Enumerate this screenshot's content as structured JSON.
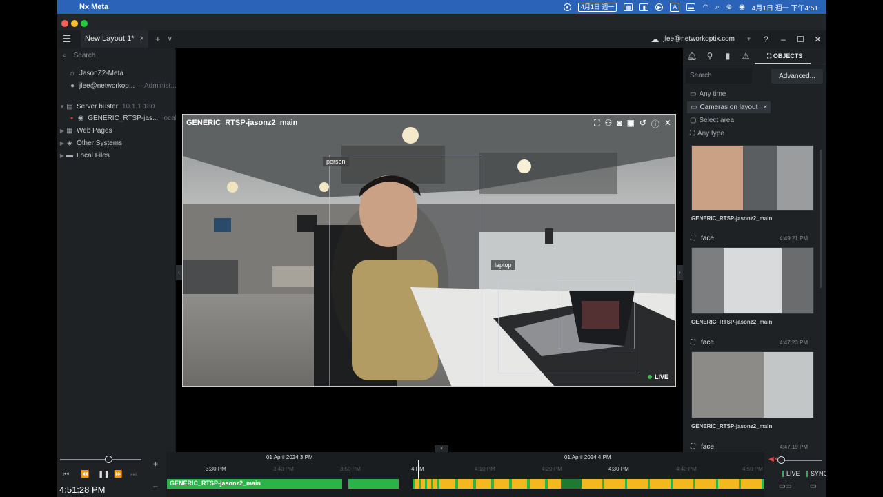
{
  "mac": {
    "app_name": "Nx Meta",
    "date_box": "4月1日 週一",
    "ime_label": "A",
    "datetime": "4月1日 週一  下午4:51"
  },
  "tabs": [
    {
      "label": "New Layout 1*"
    }
  ],
  "account": {
    "email": "jlee@networkoptix.com"
  },
  "left_panel": {
    "search_placeholder": "Search",
    "items": [
      {
        "label": "JasonZ2-Meta",
        "extra": ""
      },
      {
        "label": "jlee@networkop...",
        "extra": "– Administ..."
      },
      {
        "label": "Server buster",
        "extra": "10.1.1.180"
      },
      {
        "label": "GENERIC_RTSP-jas...",
        "extra": "local..."
      },
      {
        "label": "Web Pages",
        "extra": ""
      },
      {
        "label": "Other Systems",
        "extra": ""
      },
      {
        "label": "Local Files",
        "extra": ""
      }
    ]
  },
  "video": {
    "title": "GENERIC_RTSP-jasonz2_main",
    "labels": {
      "person": "person",
      "laptop": "laptop"
    },
    "live": "LIVE"
  },
  "right_panel": {
    "active_tab": "OBJECTS",
    "search_placeholder": "Search",
    "advanced": "Advanced...",
    "filters": {
      "time": "Any time",
      "cameras": "Cameras on layout",
      "area": "Select area",
      "type": "Any type"
    },
    "cards": [
      {
        "type": "",
        "time": "",
        "camera": "GENERIC_RTSP-jasonz2_main"
      },
      {
        "type": "face",
        "time": "4:49:21 PM",
        "camera": "GENERIC_RTSP-jasonz2_main"
      },
      {
        "type": "face",
        "time": "4:47:23 PM",
        "camera": "GENERIC_RTSP-jasonz2_main"
      },
      {
        "type": "face",
        "time": "4:47:19 PM",
        "camera": ""
      }
    ]
  },
  "timeline": {
    "clock": "4:51:28 PM",
    "days": [
      "01 April 2024 3 PM",
      "01 April 2024 4 PM"
    ],
    "ticks": [
      "3:30 PM",
      "3:40 PM",
      "3:50 PM",
      "4 PM",
      "4:10 PM",
      "4:20 PM",
      "4:30 PM",
      "4:40 PM",
      "4:50 PM"
    ],
    "camera": "GENERIC_RTSP-jasonz2_main",
    "live": "LIVE",
    "sync": "SYNC"
  }
}
